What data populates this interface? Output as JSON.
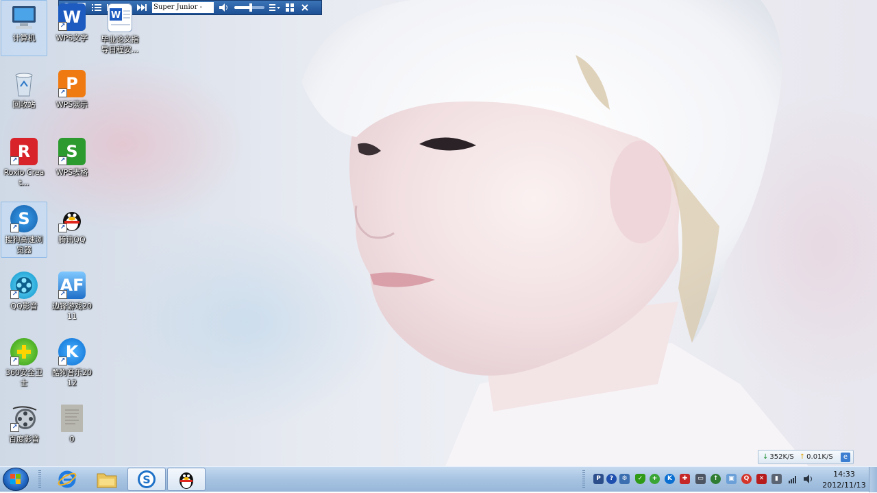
{
  "player": {
    "track_title": "Super Junior - ",
    "volume_percent": 55
  },
  "desktop_icons": [
    {
      "label": "计算机",
      "icon": "computer-icon"
    },
    {
      "label": "WPS文字",
      "icon": "wps-writer-icon"
    },
    {
      "label": "毕业论文指导日程安...",
      "icon": "word-document-icon"
    },
    {
      "label": "回收站",
      "icon": "recycle-bin-icon"
    },
    {
      "label": "WPS演示",
      "icon": "wps-presentation-icon"
    },
    {
      "label": "Roxio Creat...",
      "icon": "roxio-icon"
    },
    {
      "label": "WPS表格",
      "icon": "wps-spreadsheet-icon"
    },
    {
      "label": "搜狗高速浏览器",
      "icon": "sogou-browser-icon"
    },
    {
      "label": "腾讯QQ",
      "icon": "qq-penguin-icon"
    },
    {
      "label": "QQ影音",
      "icon": "qq-player-icon"
    },
    {
      "label": "边锋游戏2011",
      "icon": "bianfeng-games-icon"
    },
    {
      "label": "360安全卫士",
      "icon": "360-safeguard-icon"
    },
    {
      "label": "酷狗音乐2012",
      "icon": "kugou-music-icon"
    },
    {
      "label": "百度影音",
      "icon": "baidu-player-icon"
    },
    {
      "label": "0",
      "icon": "document-thumbnail-icon"
    }
  ],
  "net_speed": {
    "download": "352K/S",
    "upload": "0.01K/S"
  },
  "taskbar": {
    "pinned": [
      {
        "name": "Internet Explorer",
        "icon": "ie-icon"
      },
      {
        "name": "Windows Explorer",
        "icon": "folder-icon"
      },
      {
        "name": "搜狗高速浏览器",
        "icon": "sogou-browser-icon"
      },
      {
        "name": "腾讯QQ",
        "icon": "qq-penguin-icon"
      }
    ],
    "clock_time": "14:33",
    "clock_date": "2012/11/13"
  },
  "colors": {
    "taskbar": "#a9c5e3",
    "player_bar": "#1d4f93",
    "accent": "#1f64bf"
  }
}
